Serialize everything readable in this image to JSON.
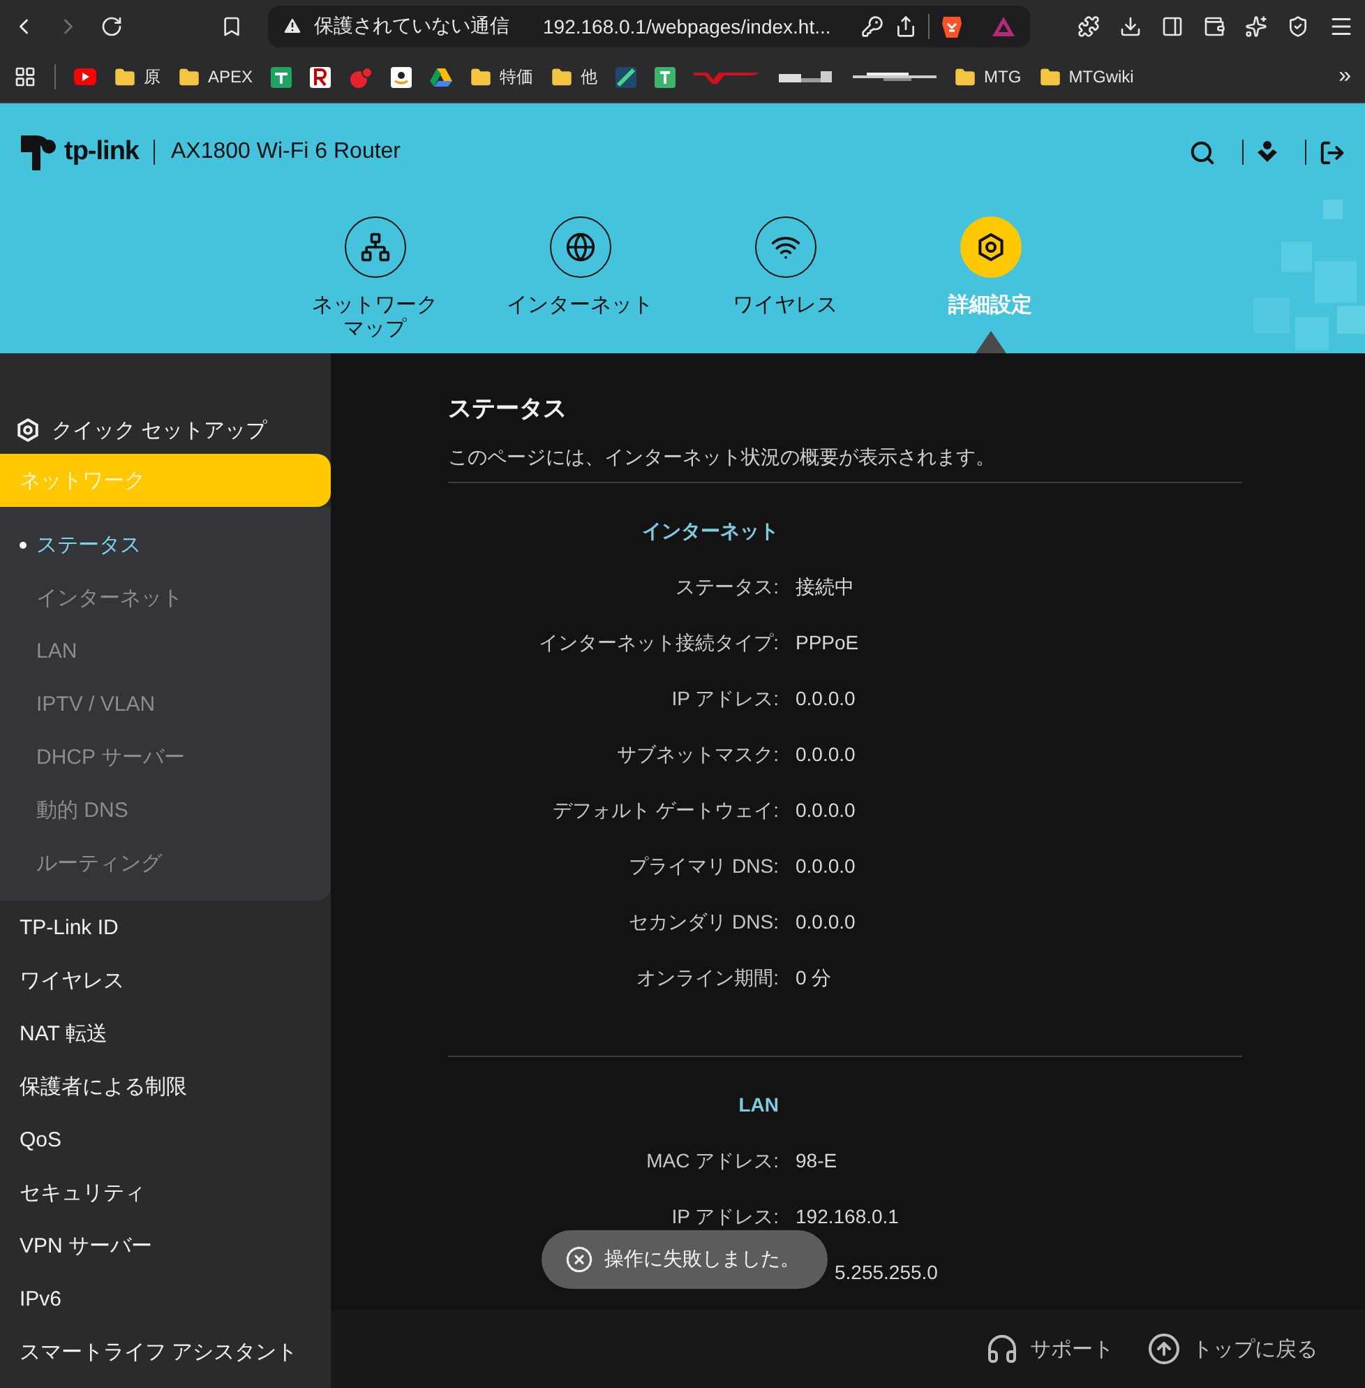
{
  "browser": {
    "back_enabled": true,
    "forward_enabled": false,
    "security_label": "保護されていない通信",
    "url": "192.168.0.1/webpages/index.ht...",
    "bookmarks": [
      {
        "kind": "youtube"
      },
      {
        "kind": "folder",
        "label": "原"
      },
      {
        "kind": "folder",
        "label": "APEX"
      },
      {
        "kind": "sheet"
      },
      {
        "kind": "rakuten"
      },
      {
        "kind": "redapp"
      },
      {
        "kind": "amazon"
      },
      {
        "kind": "drive"
      },
      {
        "kind": "folder",
        "label": "特価"
      },
      {
        "kind": "folder",
        "label": "他"
      },
      {
        "kind": "tile"
      },
      {
        "kind": "tletter"
      },
      {
        "kind": "swoosh"
      },
      {
        "kind": "blurred"
      },
      {
        "kind": "blurred2"
      },
      {
        "kind": "folder",
        "label": "MTG"
      },
      {
        "kind": "folder",
        "label": "MTGwiki"
      }
    ],
    "more": "»"
  },
  "header": {
    "brand": "tp-link",
    "model": "AX1800 Wi-Fi 6 Router",
    "nav": [
      {
        "kind": "network",
        "lines": [
          "ネットワーク",
          "マップ"
        ],
        "selected": false
      },
      {
        "kind": "globe",
        "lines": [
          "インターネット"
        ],
        "selected": false
      },
      {
        "kind": "wifi",
        "lines": [
          "ワイヤレス"
        ],
        "selected": false
      },
      {
        "kind": "gear",
        "lines": [
          "詳細設定"
        ],
        "selected": true
      }
    ]
  },
  "sidebar": {
    "quick_setup": "クイック セットアップ",
    "items": [
      {
        "label": "ネットワーク",
        "selected": true,
        "children": [
          {
            "label": "ステータス",
            "selected": true
          },
          {
            "label": "インターネット",
            "selected": false
          },
          {
            "label": "LAN",
            "selected": false
          },
          {
            "label": "IPTV / VLAN",
            "selected": false
          },
          {
            "label": "DHCP サーバー",
            "selected": false
          },
          {
            "label": "動的 DNS",
            "selected": false
          },
          {
            "label": "ルーティング",
            "selected": false
          }
        ]
      },
      {
        "label": "TP-Link ID",
        "selected": false
      },
      {
        "label": "ワイヤレス",
        "selected": false
      },
      {
        "label": "NAT 転送",
        "selected": false
      },
      {
        "label": "保護者による制限",
        "selected": false
      },
      {
        "label": "QoS",
        "selected": false
      },
      {
        "label": "セキュリティ",
        "selected": false
      },
      {
        "label": "VPN サーバー",
        "selected": false
      },
      {
        "label": "IPv6",
        "selected": false
      },
      {
        "label": "スマートライフ アシスタント",
        "selected": false
      }
    ]
  },
  "content": {
    "title": "ステータス",
    "description": "このページには、インターネット状況の概要が表示されます。",
    "sections": [
      {
        "heading": "インターネット",
        "rows": [
          {
            "label": "ステータス:",
            "value": "接続中"
          },
          {
            "label": "インターネット接続タイプ:",
            "value": "PPPoE"
          },
          {
            "label": "IP アドレス:",
            "value": "0.0.0.0"
          },
          {
            "label": "サブネットマスク:",
            "value": "0.0.0.0"
          },
          {
            "label": "デフォルト ゲートウェイ:",
            "value": "0.0.0.0"
          },
          {
            "label": "プライマリ DNS:",
            "value": "0.0.0.0"
          },
          {
            "label": "セカンダリ DNS:",
            "value": "0.0.0.0"
          },
          {
            "label": "オンライン期間:",
            "value": "0 分"
          }
        ]
      },
      {
        "heading": "LAN",
        "rows": [
          {
            "label": "MAC アドレス:",
            "value": "98-E"
          },
          {
            "label": "IP アドレス:",
            "value": "192.168.0.1"
          },
          {
            "value": "5.255.255.0"
          }
        ]
      }
    ]
  },
  "toast": {
    "message": "操作に失敗しました。"
  },
  "footer": {
    "links": [
      {
        "kind": "support",
        "label": "サポート"
      },
      {
        "kind": "top",
        "label": "トップに戻る"
      }
    ]
  }
}
